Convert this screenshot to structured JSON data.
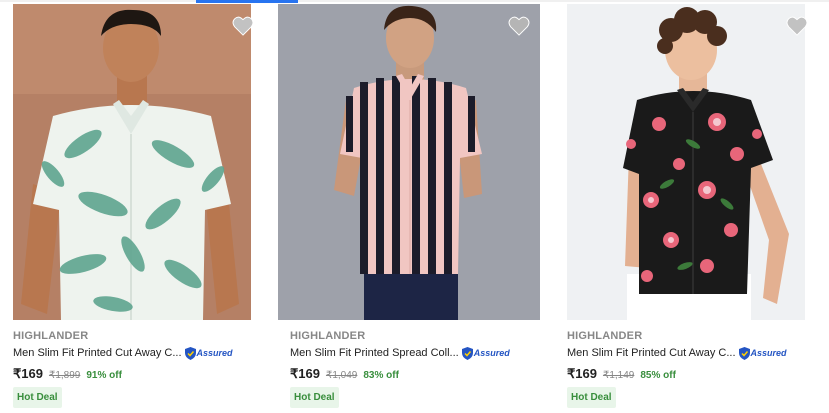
{
  "colors": {
    "accent": "#2874f0",
    "brand_text": "#878787",
    "price_text": "#212121",
    "discount_green": "#388e3c",
    "badge_bg": "#e8f5e9",
    "assured_blue": "#2455c3",
    "wishlist_grey": "#c2c2c2"
  },
  "products": [
    {
      "brand": "HIGHLANDER",
      "title": "Men Slim Fit Printed Cut Away C...",
      "assured_label": "Assured",
      "price": "₹169",
      "mrp": "₹1,899",
      "discount": "91% off",
      "badge": "Hot Deal",
      "wishlist_icon": "heart-icon"
    },
    {
      "brand": "HIGHLANDER",
      "title": "Men Slim Fit Printed Spread Coll...",
      "assured_label": "Assured",
      "price": "₹169",
      "mrp": "₹1,049",
      "discount": "83% off",
      "badge": "Hot Deal",
      "wishlist_icon": "heart-icon"
    },
    {
      "brand": "HIGHLANDER",
      "title": "Men Slim Fit Printed Cut Away C...",
      "assured_label": "Assured",
      "price": "₹169",
      "mrp": "₹1,149",
      "discount": "85% off",
      "badge": "Hot Deal",
      "wishlist_icon": "heart-icon"
    }
  ]
}
